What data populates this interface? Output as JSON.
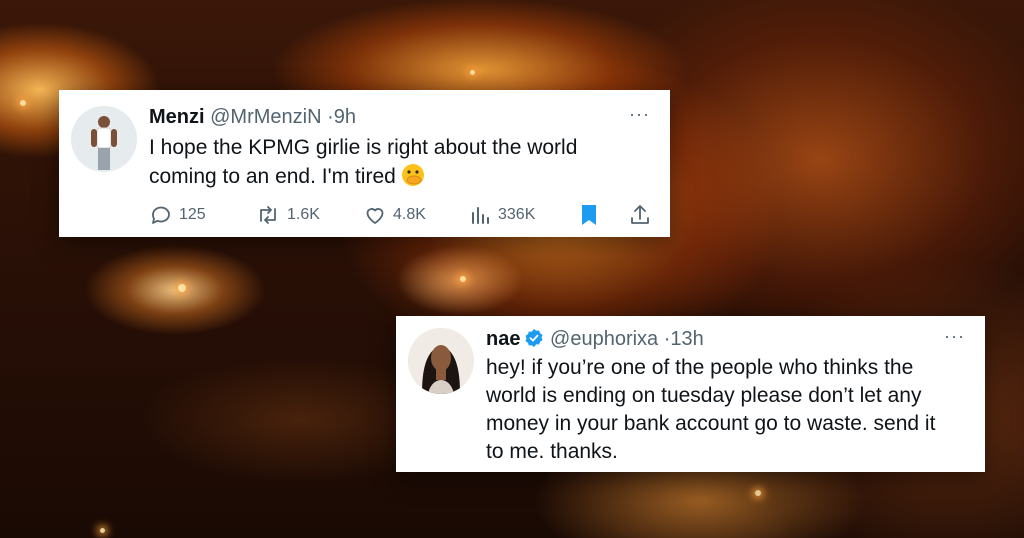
{
  "tweets": [
    {
      "name": "Menzi",
      "handle": "@MrMenziN",
      "time": "9h",
      "text_line1": "I hope the KPMG girlie is right about the world",
      "text_line2": "coming to an end. I'm tired",
      "emoji": "face-with-hand-over-mouth",
      "stats": {
        "replies": "125",
        "reposts": "1.6K",
        "likes": "4.8K",
        "views": "336K"
      },
      "more_label": "···"
    },
    {
      "name": "nae",
      "handle": "@euphorixa",
      "time": "13h",
      "verified": true,
      "text_line1": "hey! if you’re one of the people who thinks the",
      "text_line2": "world is ending on tuesday please don’t let any",
      "text_line3": "money in your bank account go to waste. send it",
      "text_line4": "to me. thanks.",
      "more_label": "···"
    }
  ],
  "colors": {
    "text": "#0f1419",
    "muted": "#536471",
    "bookmark": "#1d9bf0",
    "verified": "#1d9bf0",
    "background": "wildfire-photo"
  },
  "icons": [
    "reply-icon",
    "repost-icon",
    "like-icon",
    "views-icon",
    "bookmark-icon",
    "share-icon",
    "verified-badge-icon",
    "more-icon"
  ]
}
